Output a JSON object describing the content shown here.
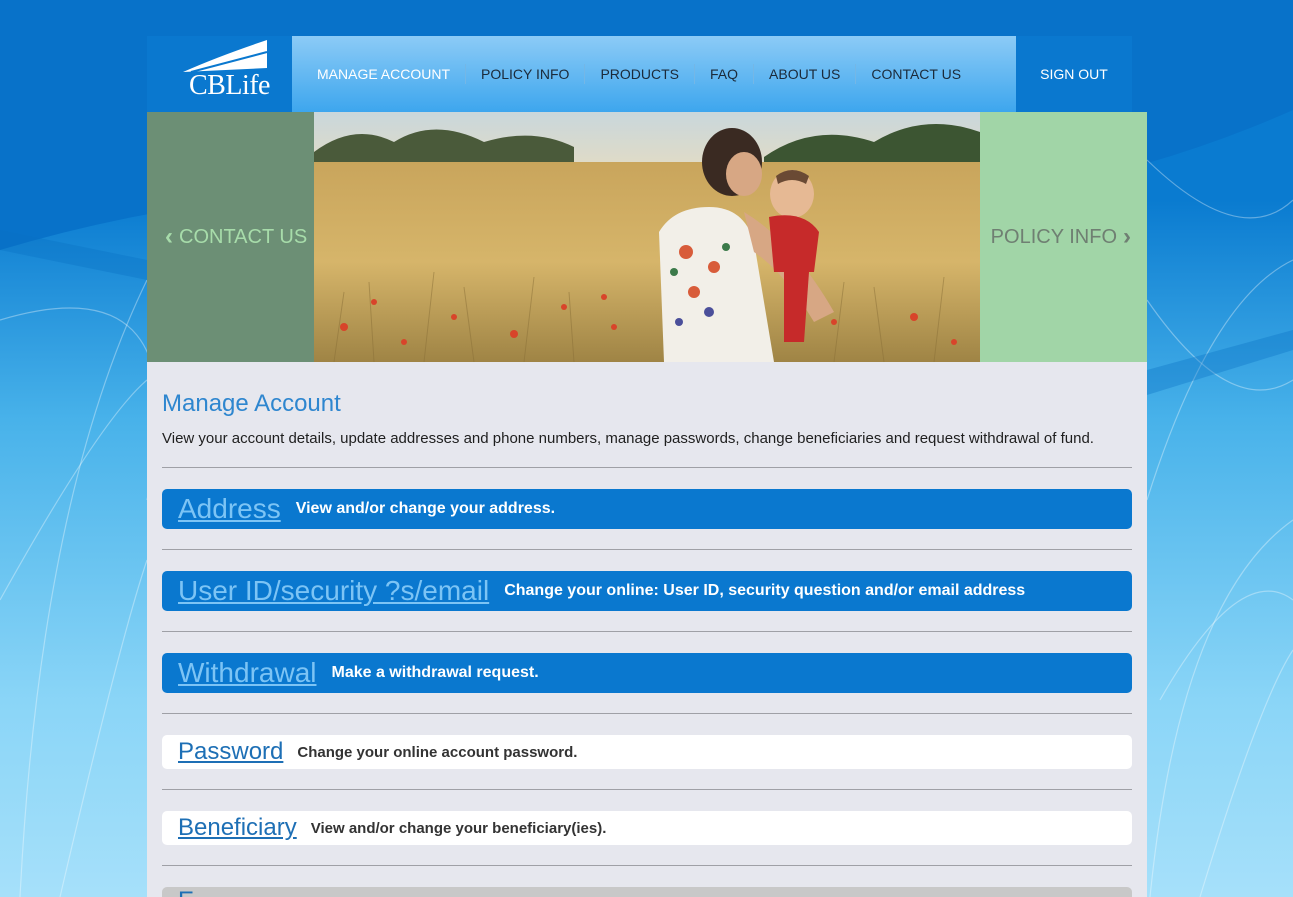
{
  "logo": {
    "text": "CBLife"
  },
  "nav": {
    "items": [
      {
        "label": "MANAGE ACCOUNT",
        "active": true
      },
      {
        "label": "POLICY INFO",
        "active": false
      },
      {
        "label": "PRODUCTS",
        "active": false
      },
      {
        "label": "FAQ",
        "active": false
      },
      {
        "label": "ABOUT US",
        "active": false
      },
      {
        "label": "CONTACT US",
        "active": false
      }
    ],
    "signout": "SIGN OUT"
  },
  "banner": {
    "prev_label": "CONTACT US",
    "next_label": "POLICY INFO"
  },
  "main": {
    "title": "Manage Account",
    "description": "View your account details, update addresses and phone numbers, manage passwords, change beneficiaries and request withdrawal of fund.",
    "sections": [
      {
        "link": "Address",
        "desc": "View and/or change your address."
      },
      {
        "link": "User ID/security ?s/email",
        "desc": "Change your online: User ID, security question and/or email address"
      },
      {
        "link": "Withdrawal",
        "desc": "Make a withdrawal request."
      },
      {
        "link": "Password",
        "desc": "Change your online account password."
      },
      {
        "link": "Beneficiary",
        "desc": "View and/or change your beneficiary(ies)."
      },
      {
        "link": "E"
      }
    ]
  },
  "colors": {
    "brand_blue": "#0a78cf",
    "title_blue": "#2e86cf",
    "content_bg": "#e6e7ee"
  }
}
